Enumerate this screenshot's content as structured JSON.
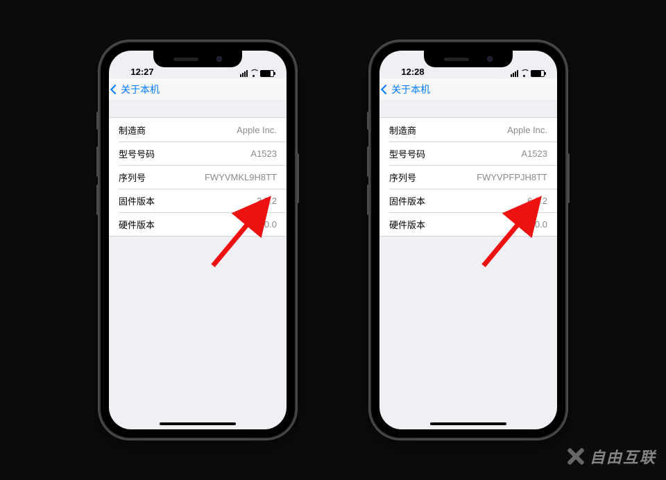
{
  "watermark": "自由互联",
  "phones": [
    {
      "time": "12:27",
      "back_label": "关于本机",
      "rows": [
        {
          "label": "制造商",
          "value": "Apple Inc."
        },
        {
          "label": "型号号码",
          "value": "A1523"
        },
        {
          "label": "序列号",
          "value": "FWYVMKL9H8TT"
        },
        {
          "label": "固件版本",
          "value": "3.7.2"
        },
        {
          "label": "硬件版本",
          "value": "1.0.0"
        }
      ]
    },
    {
      "time": "12:28",
      "back_label": "关于本机",
      "rows": [
        {
          "label": "制造商",
          "value": "Apple Inc."
        },
        {
          "label": "型号号码",
          "value": "A1523"
        },
        {
          "label": "序列号",
          "value": "FWYVPFPJH8TT"
        },
        {
          "label": "固件版本",
          "value": "6.3.2"
        },
        {
          "label": "硬件版本",
          "value": "1.0.0"
        }
      ]
    }
  ]
}
